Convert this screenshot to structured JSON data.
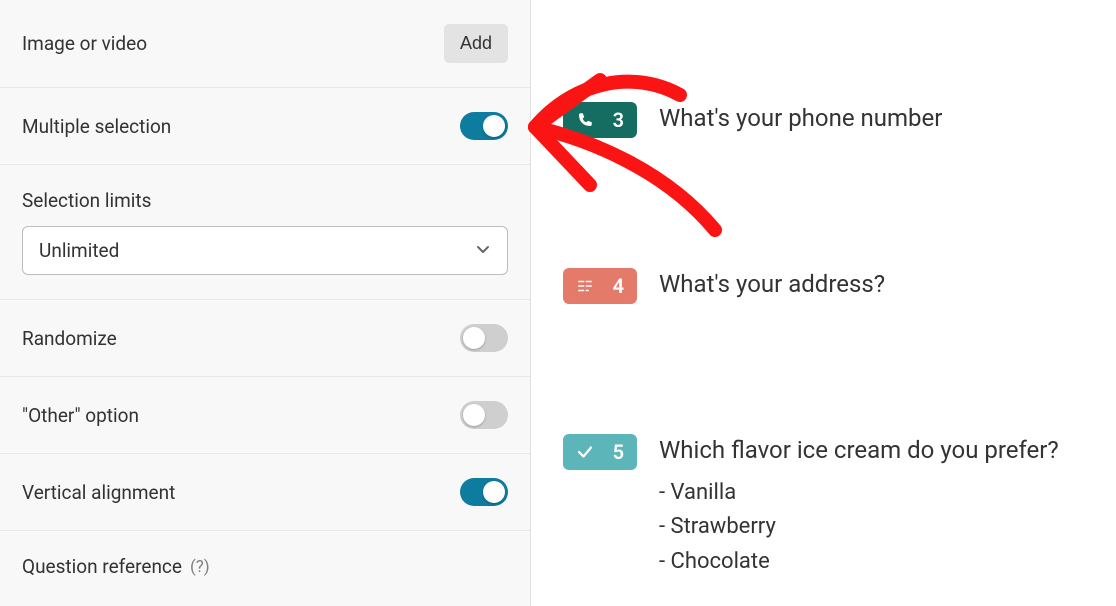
{
  "colors": {
    "accent": "#0e7c9e",
    "toggle_off": "#cfcfcf",
    "badge_teal_dark": "#156d62",
    "badge_salmon": "#e47a6a",
    "badge_teal_light": "#5bb5b9",
    "annotation_red": "#fb1414"
  },
  "settings": {
    "image_or_video": {
      "label": "Image or video",
      "button": "Add"
    },
    "multiple_selection": {
      "label": "Multiple selection",
      "value": true
    },
    "selection_limits": {
      "label": "Selection limits",
      "selected": "Unlimited"
    },
    "randomize": {
      "label": "Randomize",
      "value": false
    },
    "other_option": {
      "label": "\"Other\" option",
      "value": false
    },
    "vertical_alignment": {
      "label": "Vertical alignment",
      "value": true
    },
    "question_reference": {
      "label": "Question reference",
      "help": "(?)"
    }
  },
  "questions": [
    {
      "number": "3",
      "badge_color": "#156d62",
      "icon": "phone-icon",
      "text": "What's your phone number"
    },
    {
      "number": "4",
      "badge_color": "#e47a6a",
      "icon": "address-icon",
      "text": "What's your address?"
    },
    {
      "number": "5",
      "badge_color": "#5bb5b9",
      "icon": "check-icon",
      "text": "Which flavor ice cream do you prefer?",
      "choices": [
        "- Vanilla",
        "- Strawberry",
        "- Chocolate"
      ]
    }
  ]
}
